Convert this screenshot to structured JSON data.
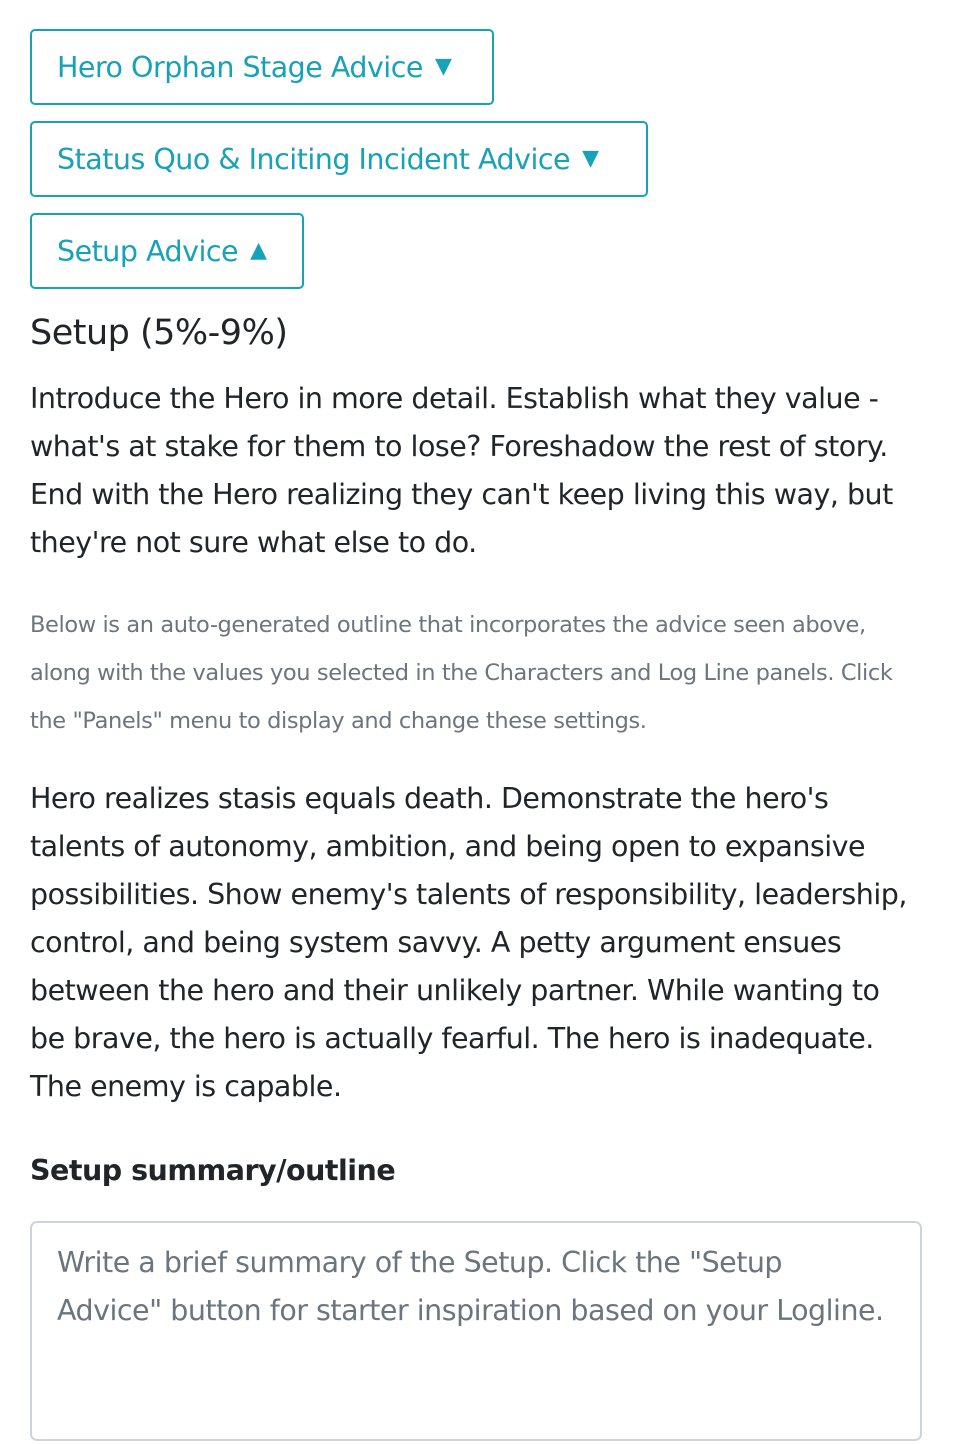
{
  "buttons": {
    "hero_orphan": {
      "label": "Hero Orphan Stage Advice",
      "caret": "▼"
    },
    "status_quo": {
      "label": "Status Quo & Inciting Incident Advice",
      "caret": "▼"
    },
    "setup": {
      "label": "Setup Advice",
      "caret": "▲"
    }
  },
  "setup": {
    "title": "Setup (5%-9%)",
    "advice": "Introduce the Hero in more detail. Establish what they value - what's at stake for them to lose? Foreshadow the rest of story. End with the Hero realizing they can't keep living this way, but they're not sure what else to do.",
    "note": "Below is an auto-generated outline that incorporates the advice seen above, along with the values you selected in the Characters and Log Line panels. Click the \"Panels\" menu to display and change these settings.",
    "outline": "Hero realizes stasis equals death. Demonstrate the hero's talents of autonomy, ambition, and being open to expansive possibilities. Show enemy's talents of responsibility, leadership, control, and being system savvy. A petty argument ensues between the hero and their unlikely partner. While wanting to be brave, the hero is actually fearful. The hero is inadequate. The enemy is capable."
  },
  "summary": {
    "label": "Setup summary/outline",
    "placeholder": "Write a brief summary of the Setup. Click the \"Setup Advice\" button for starter inspiration based on your Logline.",
    "value": ""
  },
  "colors": {
    "accent": "#17a2b8",
    "muted": "#6c757d",
    "text": "#212529",
    "input_border": "#ced4da"
  }
}
